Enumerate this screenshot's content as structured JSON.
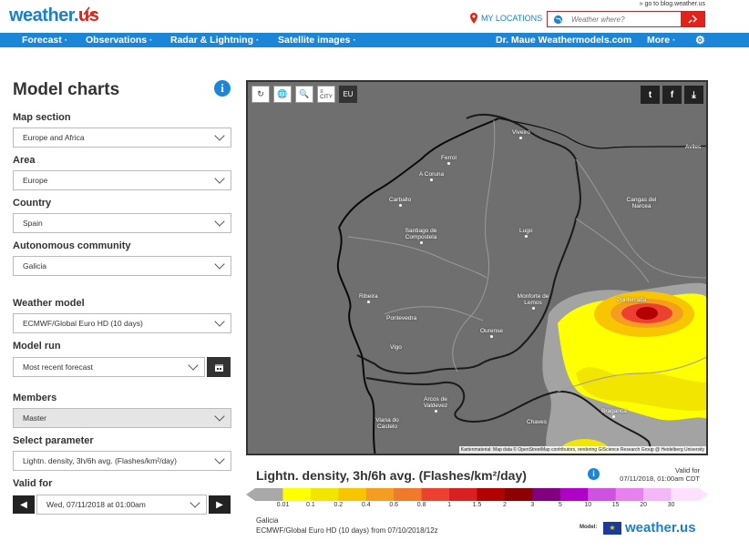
{
  "header": {
    "logo_text": "weather.",
    "logo_suffix": "us",
    "blog_link": "» go to blog.weather.us",
    "my_locations": "MY LOCATIONS",
    "search_placeholder": "Weather where?"
  },
  "nav": {
    "items": [
      "Forecast",
      "Observations",
      "Radar & Lightning",
      "Satellite images",
      "Dr. Maue Weathermodels.com",
      "More"
    ]
  },
  "sidebar": {
    "title": "Model charts",
    "fields": [
      {
        "label": "Map section",
        "value": "Europe and Africa"
      },
      {
        "label": "Area",
        "value": "Europe"
      },
      {
        "label": "Country",
        "value": "Spain"
      },
      {
        "label": "Autonomous community",
        "value": "Galicia"
      },
      {
        "label": "Weather model",
        "value": "ECMWF/Global Euro HD (10 days)"
      },
      {
        "label": "Model run",
        "value": "Most recent forecast"
      },
      {
        "label": "Members",
        "value": "Master"
      },
      {
        "label": "Select parameter",
        "value": "Lightn. density, 3h/6h avg. (Flashes/km²/day)"
      },
      {
        "label": "Valid for",
        "value": "Wed, 07/11/2018 at 01:00am"
      }
    ]
  },
  "map": {
    "toolbar": [
      "↻",
      "🌐",
      "🔍",
      "EU"
    ],
    "attribution": "Kartenmaterial: Map data © OpenStreetMap contributors, rendering GIScience Research Group @ Heidelberg University",
    "cities": [
      {
        "name": "Viveiro"
      },
      {
        "name": "Aviles"
      },
      {
        "name": "Ferrol"
      },
      {
        "name": "A Coruna"
      },
      {
        "name": "Carballo"
      },
      {
        "name": "Cangas del Narcea"
      },
      {
        "name": "Santiago de Compostela"
      },
      {
        "name": "Lugo"
      },
      {
        "name": "Ribeira"
      },
      {
        "name": "Ponferrada"
      },
      {
        "name": "Monforte de Lemos"
      },
      {
        "name": "Pontevedra"
      },
      {
        "name": "Vigo"
      },
      {
        "name": "Ourense"
      },
      {
        "name": "Arcos de Valdevez"
      },
      {
        "name": "Viana do Castelo"
      },
      {
        "name": "Chaves"
      },
      {
        "name": "Braganca"
      }
    ]
  },
  "legend": {
    "title": "Lightn. density, 3h/6h avg. (Flashes/km²/day)",
    "valid_for_label": "Valid for",
    "valid_for_value": "07/11/2018, 01:00am CDT",
    "values": [
      "0.01",
      "0.1",
      "0.2",
      "0.4",
      "0.6",
      "0.8",
      "1",
      "1.5",
      "2",
      "3",
      "5",
      "10",
      "15",
      "20",
      "30"
    ],
    "colors": [
      "#a9a9a9",
      "#ffff00",
      "#f2e600",
      "#f7c600",
      "#f59d20",
      "#f07a2a",
      "#ee4030",
      "#d91f1f",
      "#b30000",
      "#8c0000",
      "#800080",
      "#b000c8",
      "#d050e0",
      "#e880f0",
      "#f4b8f8",
      "#ffe0ff"
    ],
    "region": "Galicia",
    "model_line": "ECMWF/Global Euro HD (10 days) from 07/10/2018/12z",
    "model_label": "Model:",
    "model_logo": "weather.us"
  }
}
